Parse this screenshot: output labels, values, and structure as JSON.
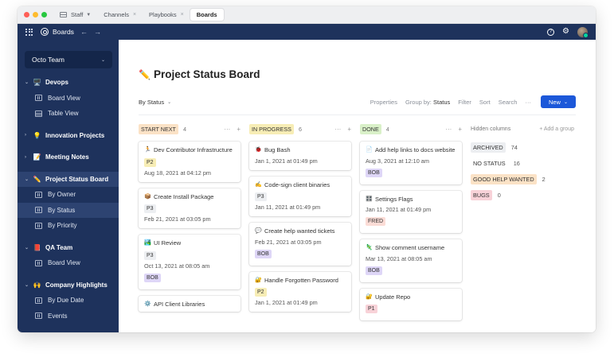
{
  "browser": {
    "team_tab": "Staff",
    "tabs": [
      {
        "label": "Channels",
        "active": false
      },
      {
        "label": "Playbooks",
        "active": false
      },
      {
        "label": "Boards",
        "active": true
      }
    ],
    "close_glyph": "×"
  },
  "header": {
    "app_name": "Boards",
    "back_glyph": "←",
    "forward_glyph": "→",
    "help_glyph": "?",
    "settings_glyph": "⚙"
  },
  "colors": {
    "sidebar": "#1e325c",
    "accent": "#1c58d9"
  },
  "sidebar": {
    "team": "Octo Team",
    "groups": [
      {
        "label": "Devops",
        "emoji": "🖥️",
        "expanded": true,
        "views": [
          {
            "label": "Board View",
            "icon": "board-icon"
          },
          {
            "label": "Table View",
            "icon": "table-icon"
          }
        ]
      },
      {
        "label": "Innovation Projects",
        "emoji": "💡",
        "expanded": false,
        "views": []
      },
      {
        "label": "Meeting Notes",
        "emoji": "📝",
        "expanded": false,
        "views": []
      },
      {
        "label": "Project Status Board",
        "emoji": "✏️",
        "expanded": true,
        "selected": true,
        "views": [
          {
            "label": "By Owner",
            "icon": "board-icon"
          },
          {
            "label": "By Status",
            "icon": "board-icon",
            "active": true
          },
          {
            "label": "By Priority",
            "icon": "board-icon"
          }
        ]
      },
      {
        "label": "QA Team",
        "emoji": "📕",
        "expanded": true,
        "views": [
          {
            "label": "Board View",
            "icon": "board-icon"
          }
        ]
      },
      {
        "label": "Company Highlights",
        "emoji": "🙌",
        "expanded": true,
        "views": [
          {
            "label": "By Due Date",
            "icon": "board-icon"
          },
          {
            "label": "Events",
            "icon": "board-icon"
          }
        ]
      }
    ]
  },
  "board": {
    "icon": "✏️",
    "title": "Project Status Board",
    "view_selector": "By Status",
    "toolbar": {
      "properties": "Properties",
      "group_by_label": "Group by:",
      "group_by_value": "Status",
      "filter": "Filter",
      "sort": "Sort",
      "search": "Search",
      "more": "···",
      "new": "New"
    },
    "columns": [
      {
        "name": "START NEXT",
        "count": "4",
        "pill_color": "#fbe2c6",
        "cards": [
          {
            "emoji": "🏃",
            "title": "Dev Contributor Infrastructure",
            "badge": "P2",
            "badge_color": "#f7edb5",
            "date": "Aug 18, 2021 at 04:12 pm"
          },
          {
            "emoji": "📦",
            "title": "Create Install Package",
            "badge": "P3",
            "badge_color": "#eceef1",
            "date": "Feb 21, 2021 at 03:05 pm"
          },
          {
            "emoji": "🏞️",
            "title": "UI Review",
            "badge": "P3",
            "badge_color": "#eceef1",
            "date": "Oct 13, 2021 at 08:05 am",
            "owner": "BOB",
            "owner_color": "#ded6f7"
          },
          {
            "emoji": "⚙️",
            "title": "API Client Libraries"
          }
        ]
      },
      {
        "name": "IN PROGRESS",
        "count": "6",
        "pill_color": "#f7edb5",
        "cards": [
          {
            "emoji": "🐞",
            "title": "Bug Bash",
            "date": "Jan 1, 2021 at 01:49 pm"
          },
          {
            "emoji": "✍️",
            "title": "Code-sign client binaries",
            "badge": "P3",
            "badge_color": "#eceef1",
            "date": "Jan 11, 2021 at 01:49 pm"
          },
          {
            "emoji": "💬",
            "title": "Create help wanted tickets",
            "date": "Feb 21, 2021 at 03:05 pm",
            "owner": "BOB",
            "owner_color": "#ded6f7"
          },
          {
            "emoji": "🔐",
            "title": "Handle Forgotten Password",
            "badge": "P2",
            "badge_color": "#f7edb5",
            "date": "Jan 1, 2021 at 01:49 pm"
          }
        ]
      },
      {
        "name": "DONE",
        "count": "4",
        "pill_color": "#d9f0c8",
        "cards": [
          {
            "emoji": "📄",
            "title": "Add help links to docs website",
            "date": "Aug 3, 2021 at 12:10 am",
            "owner": "BOB",
            "owner_color": "#ded6f7"
          },
          {
            "emoji": "🎛️",
            "title": "Settings Flags",
            "date": "Jan 11, 2021 at 01:49 pm",
            "owner": "FRED",
            "owner_color": "#fbdcd6"
          },
          {
            "emoji": "🦎",
            "title": "Show comment username",
            "date": "Mar 13, 2021 at 08:05 am",
            "owner": "BOB",
            "owner_color": "#ded6f7"
          },
          {
            "emoji": "🔐",
            "title": "Update Repo",
            "badge": "P1",
            "badge_color": "#f8d2d8"
          }
        ]
      }
    ],
    "column_more": "···",
    "column_add": "+",
    "hidden": {
      "label": "Hidden columns",
      "add_group": "+ Add a group",
      "items": [
        {
          "name": "ARCHIVED",
          "count": "74",
          "color": "#eceef1"
        },
        {
          "name": "NO STATUS",
          "count": "16",
          "color": "#ffffff"
        },
        {
          "name": "GOOD HELP WANTED",
          "count": "2",
          "color": "#fbe2c6"
        },
        {
          "name": "BUGS",
          "count": "0",
          "color": "#f8d2d8"
        }
      ]
    }
  }
}
